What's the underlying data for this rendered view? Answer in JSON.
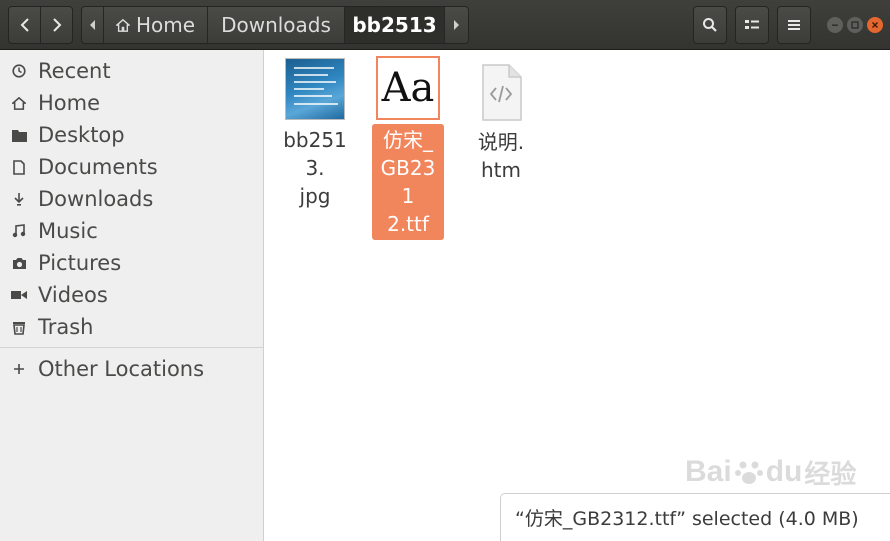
{
  "header": {
    "path": {
      "home_label": "Home",
      "downloads_label": "Downloads",
      "current_label": "bb2513"
    },
    "icons": [
      "back-icon",
      "forward-icon",
      "search-icon",
      "list-view-icon",
      "menu-icon",
      "minimize-icon",
      "maximize-icon",
      "close-icon"
    ]
  },
  "sidebar": {
    "items": [
      {
        "label": "Recent",
        "icon": "clock-icon"
      },
      {
        "label": "Home",
        "icon": "home-icon"
      },
      {
        "label": "Desktop",
        "icon": "folder-icon"
      },
      {
        "label": "Documents",
        "icon": "document-icon"
      },
      {
        "label": "Downloads",
        "icon": "download-icon"
      },
      {
        "label": "Music",
        "icon": "music-icon"
      },
      {
        "label": "Pictures",
        "icon": "camera-icon"
      },
      {
        "label": "Videos",
        "icon": "video-icon"
      },
      {
        "label": "Trash",
        "icon": "trash-icon"
      }
    ],
    "other_locations": {
      "label": "Other Locations",
      "icon": "plus-icon"
    }
  },
  "files": [
    {
      "name_line1": "bb2513.",
      "name_line2": "jpg",
      "type": "image"
    },
    {
      "name_line1": "仿宋_",
      "name_line2": "GB231",
      "name_line3": "2.ttf",
      "type": "font",
      "selected": true,
      "thumb_text": "Aa"
    },
    {
      "name_line1": "说明.",
      "name_line2": "htm",
      "type": "html"
    }
  ],
  "status": {
    "text": "“仿宋_GB2312.ttf” selected (4.0 MB)"
  },
  "watermark": {
    "text": "Bai",
    "text2": "du",
    "text3": "经验"
  },
  "colors": {
    "header_bg": "#3c3c38",
    "sidebar_bg": "#efefef",
    "selection": "#f1855c",
    "close_button": "#e4672f"
  }
}
